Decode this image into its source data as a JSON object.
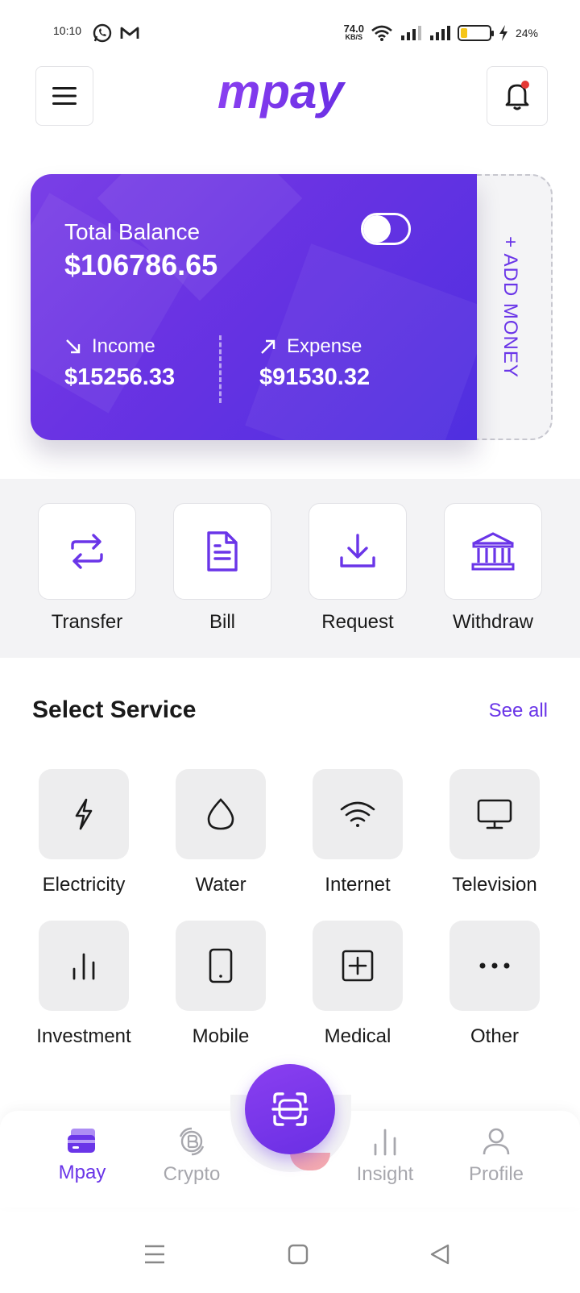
{
  "status_bar": {
    "time": "10:10",
    "net_speed_value": "74.0",
    "net_speed_unit": "KB/S",
    "battery_percent": "24%",
    "battery_level": 0.24,
    "icons": [
      "whatsapp-icon",
      "gmail-icon",
      "wifi-icon",
      "signal-icon",
      "charging-icon"
    ]
  },
  "header": {
    "logo_text": "mpay",
    "menu_icon": "hamburger-icon",
    "bell_icon": "bell-icon",
    "has_notification_dot": true
  },
  "balance_card": {
    "total_label": "Total Balance",
    "total_amount": "$106786.65",
    "income_label": "Income",
    "income_amount": "$15256.33",
    "expense_label": "Expense",
    "expense_amount": "$91530.32",
    "add_money_label": "+ ADD MONEY"
  },
  "quick_actions": [
    {
      "label": "Transfer",
      "icon": "transfer-icon"
    },
    {
      "label": "Bill",
      "icon": "document-icon"
    },
    {
      "label": "Request",
      "icon": "download-icon"
    },
    {
      "label": "Withdraw",
      "icon": "bank-icon"
    }
  ],
  "services_section": {
    "title": "Select Service",
    "see_all_label": "See all",
    "items": [
      {
        "label": "Electricity",
        "icon": "lightning-icon"
      },
      {
        "label": "Water",
        "icon": "water-drop-icon"
      },
      {
        "label": "Internet",
        "icon": "wifi-icon"
      },
      {
        "label": "Television",
        "icon": "monitor-icon"
      },
      {
        "label": "Investment",
        "icon": "bar-chart-icon"
      },
      {
        "label": "Mobile",
        "icon": "mobile-icon"
      },
      {
        "label": "Medical",
        "icon": "medical-plus-icon"
      },
      {
        "label": "Other",
        "icon": "more-dots-icon"
      }
    ]
  },
  "bottom_nav": {
    "items": [
      {
        "label": "Mpay",
        "icon": "card-icon",
        "active": true
      },
      {
        "label": "Crypto",
        "icon": "crypto-icon",
        "active": false
      },
      {
        "label": "Insight",
        "icon": "bar-chart-icon",
        "active": false
      },
      {
        "label": "Profile",
        "icon": "profile-icon",
        "active": false
      }
    ],
    "scan_icon": "scan-icon"
  },
  "colors": {
    "accent": "#6a35e8",
    "card_gradient_start": "#7a3fe6",
    "card_gradient_end": "#4f2fe0",
    "inactive_nav": "#a7a7ad",
    "battery": "#f5c518"
  }
}
